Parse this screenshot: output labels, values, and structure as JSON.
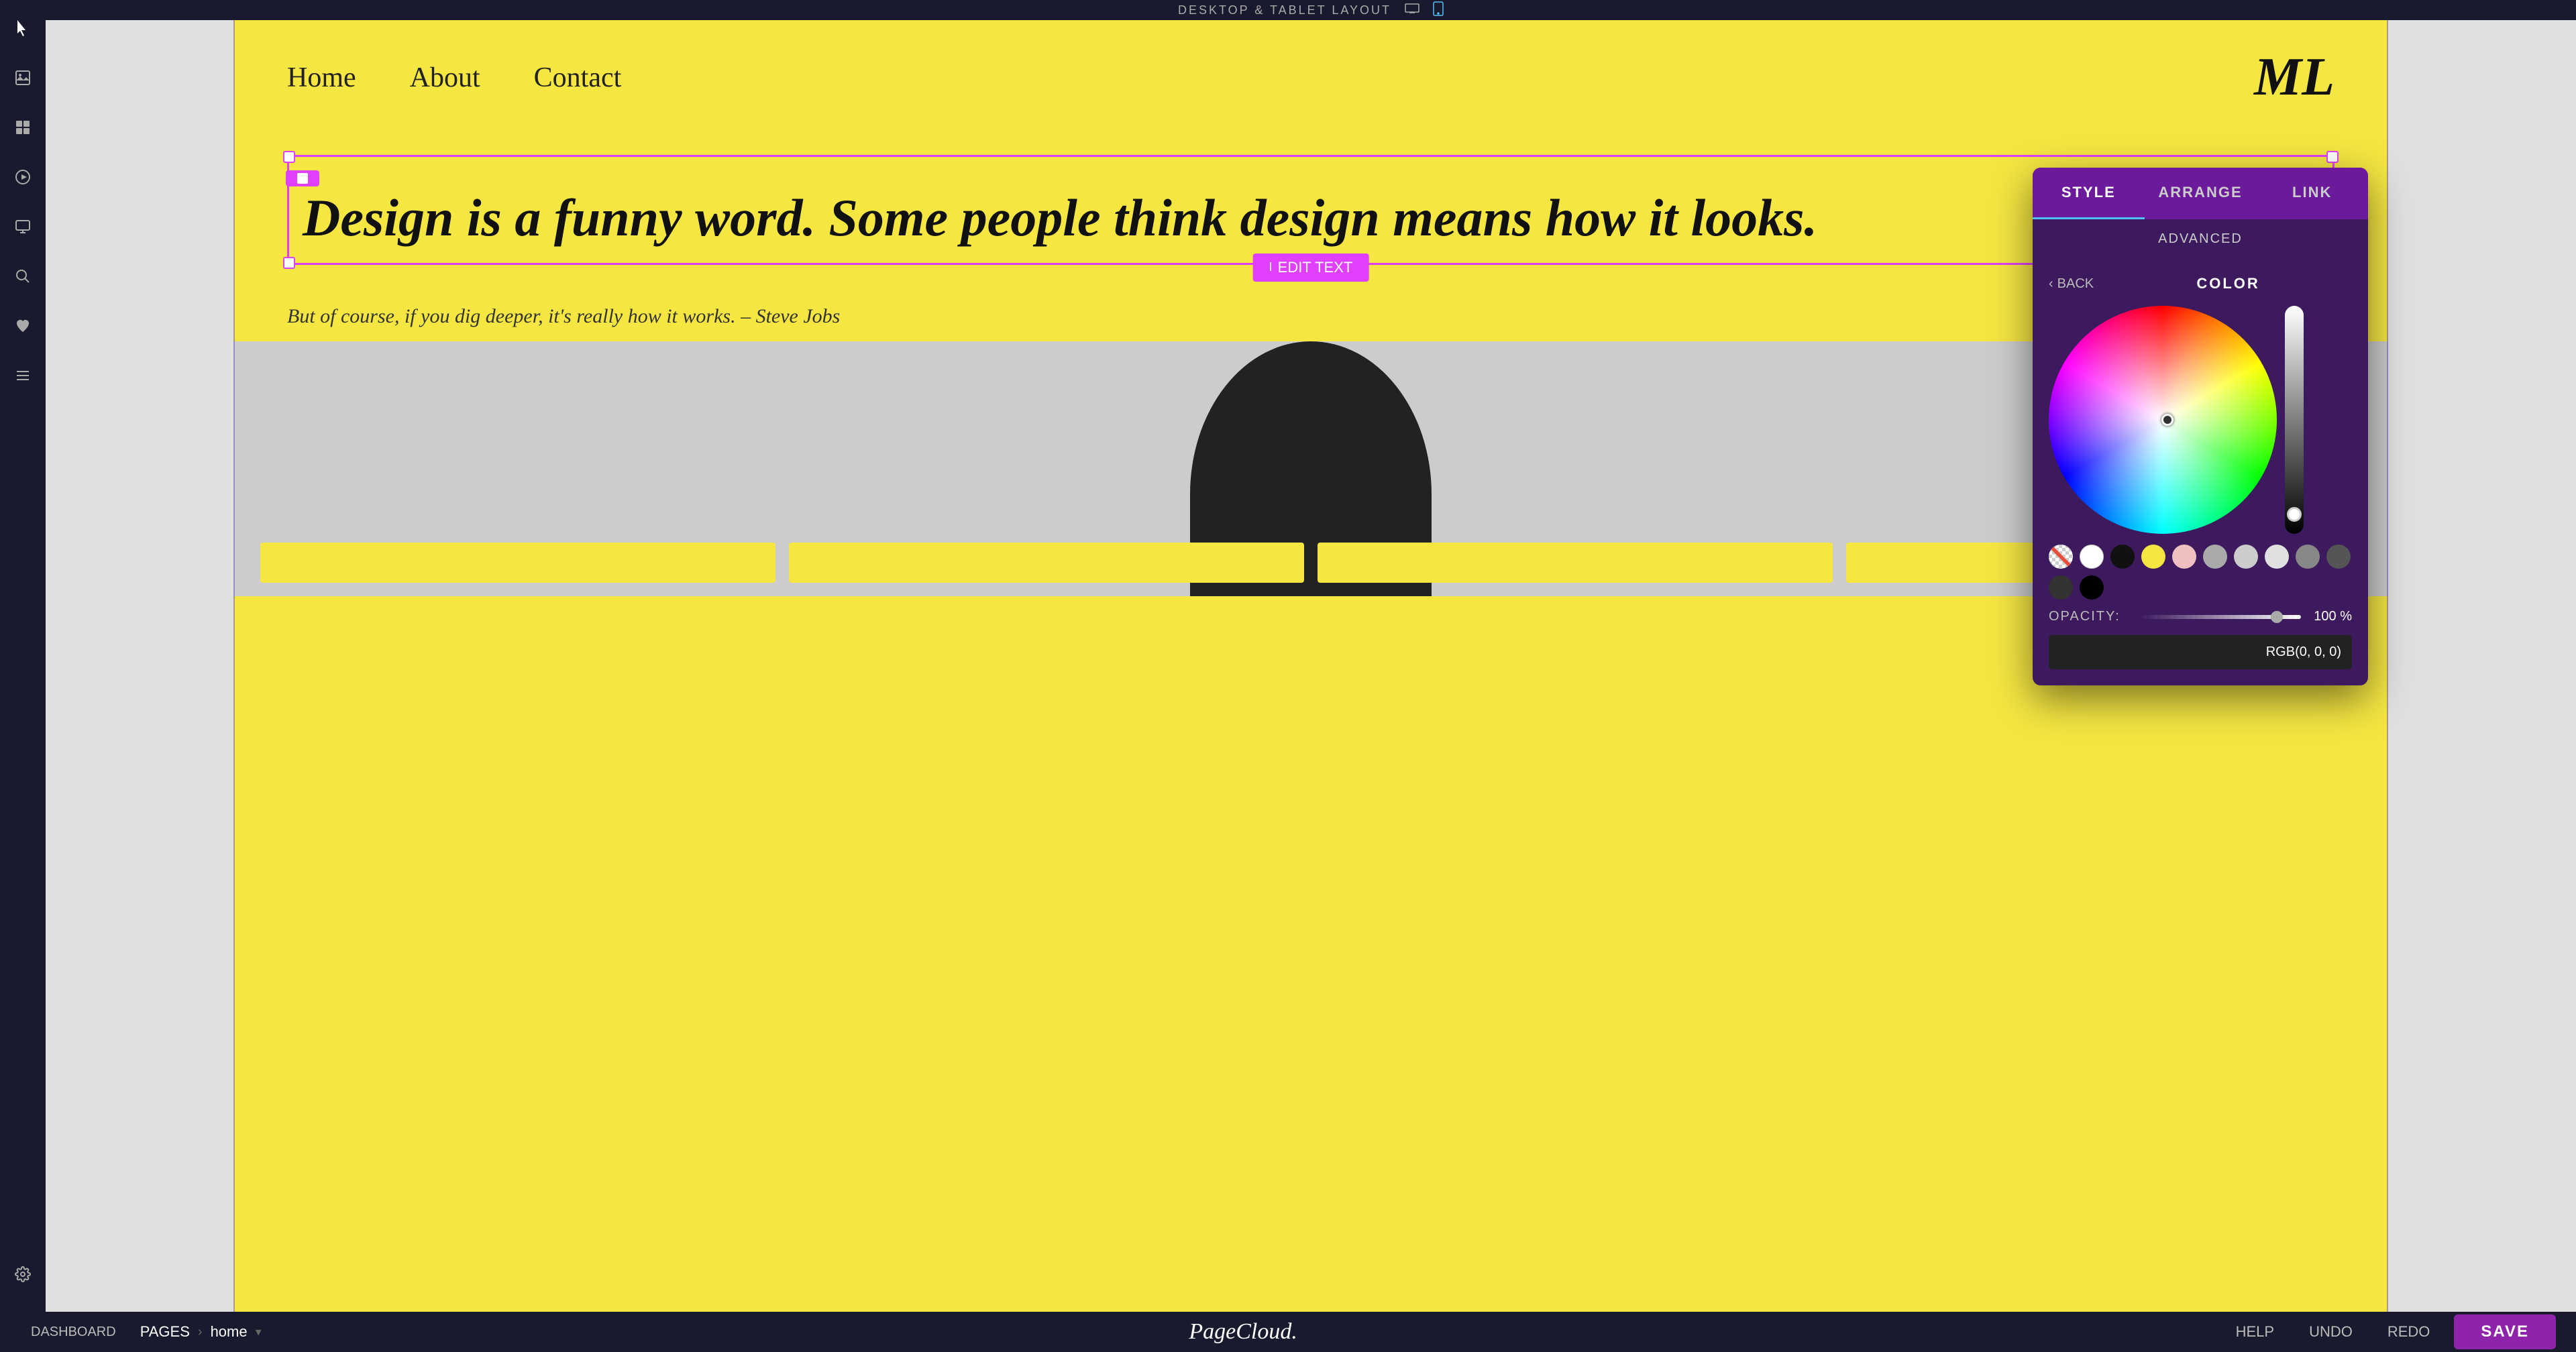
{
  "app": {
    "title": "PageCloud",
    "brand_logo": "PageCloud."
  },
  "top_bar": {
    "layout_label": "DESKTOP & TABLET LAYOUT"
  },
  "sidebar": {
    "icons": [
      {
        "name": "cursor-icon",
        "symbol": "⊹"
      },
      {
        "name": "image-icon",
        "symbol": "🖼"
      },
      {
        "name": "widget-icon",
        "symbol": "⊞"
      },
      {
        "name": "video-icon",
        "symbol": "▶"
      },
      {
        "name": "screen-icon",
        "symbol": "🖥"
      },
      {
        "name": "search-icon",
        "symbol": "🔍"
      },
      {
        "name": "heart-icon",
        "symbol": "♥"
      },
      {
        "name": "menu-icon",
        "symbol": "☰"
      },
      {
        "name": "settings-icon",
        "symbol": "⚙"
      },
      {
        "name": "sidebar-bottom-icon",
        "symbol": "⊟"
      }
    ]
  },
  "preview": {
    "nav": {
      "links": [
        "Home",
        "About",
        "Contact"
      ],
      "brand": "ML"
    },
    "main_quote": "Design is a funny word. Some people think design means how it looks.",
    "sub_quote": "But of course, if you dig deeper, it's really how it works.  – Steve Jobs",
    "edit_text_label": "EDIT TEXT"
  },
  "color_panel": {
    "tabs": [
      "STYLE",
      "ARRANGE",
      "LINK"
    ],
    "advanced_tab": "ADVANCED",
    "back_label": "BACK",
    "section_label": "COLOR",
    "opacity_label": "OPACITY:",
    "opacity_value": "100 %",
    "rgb_value": "RGB(0, 0, 0)",
    "swatches": [
      {
        "color": "transparent",
        "name": "transparent-swatch"
      },
      {
        "color": "#ffffff",
        "name": "white-swatch"
      },
      {
        "color": "#111111",
        "name": "black-swatch"
      },
      {
        "color": "#f5e642",
        "name": "yellow-swatch"
      },
      {
        "color": "#f0c0c0",
        "name": "pink-light-swatch"
      },
      {
        "color": "#aaaaaa",
        "name": "gray-swatch"
      },
      {
        "color": "#cccccc",
        "name": "light-gray-swatch"
      },
      {
        "color": "#e0e0e0",
        "name": "lighter-gray-swatch"
      },
      {
        "color": "#888888",
        "name": "medium-gray-swatch"
      },
      {
        "color": "#444444",
        "name": "dark-gray-swatch"
      },
      {
        "color": "#222222",
        "name": "darker-gray-swatch"
      },
      {
        "color": "#000000",
        "name": "pure-black-swatch"
      }
    ]
  },
  "bottom_bar": {
    "dashboard_label": "DASHBOARD",
    "pages_label": "PAGES",
    "page_name": "home",
    "help_label": "HELP",
    "undo_label": "UNDO",
    "redo_label": "REDO",
    "save_label": "SAVE"
  }
}
